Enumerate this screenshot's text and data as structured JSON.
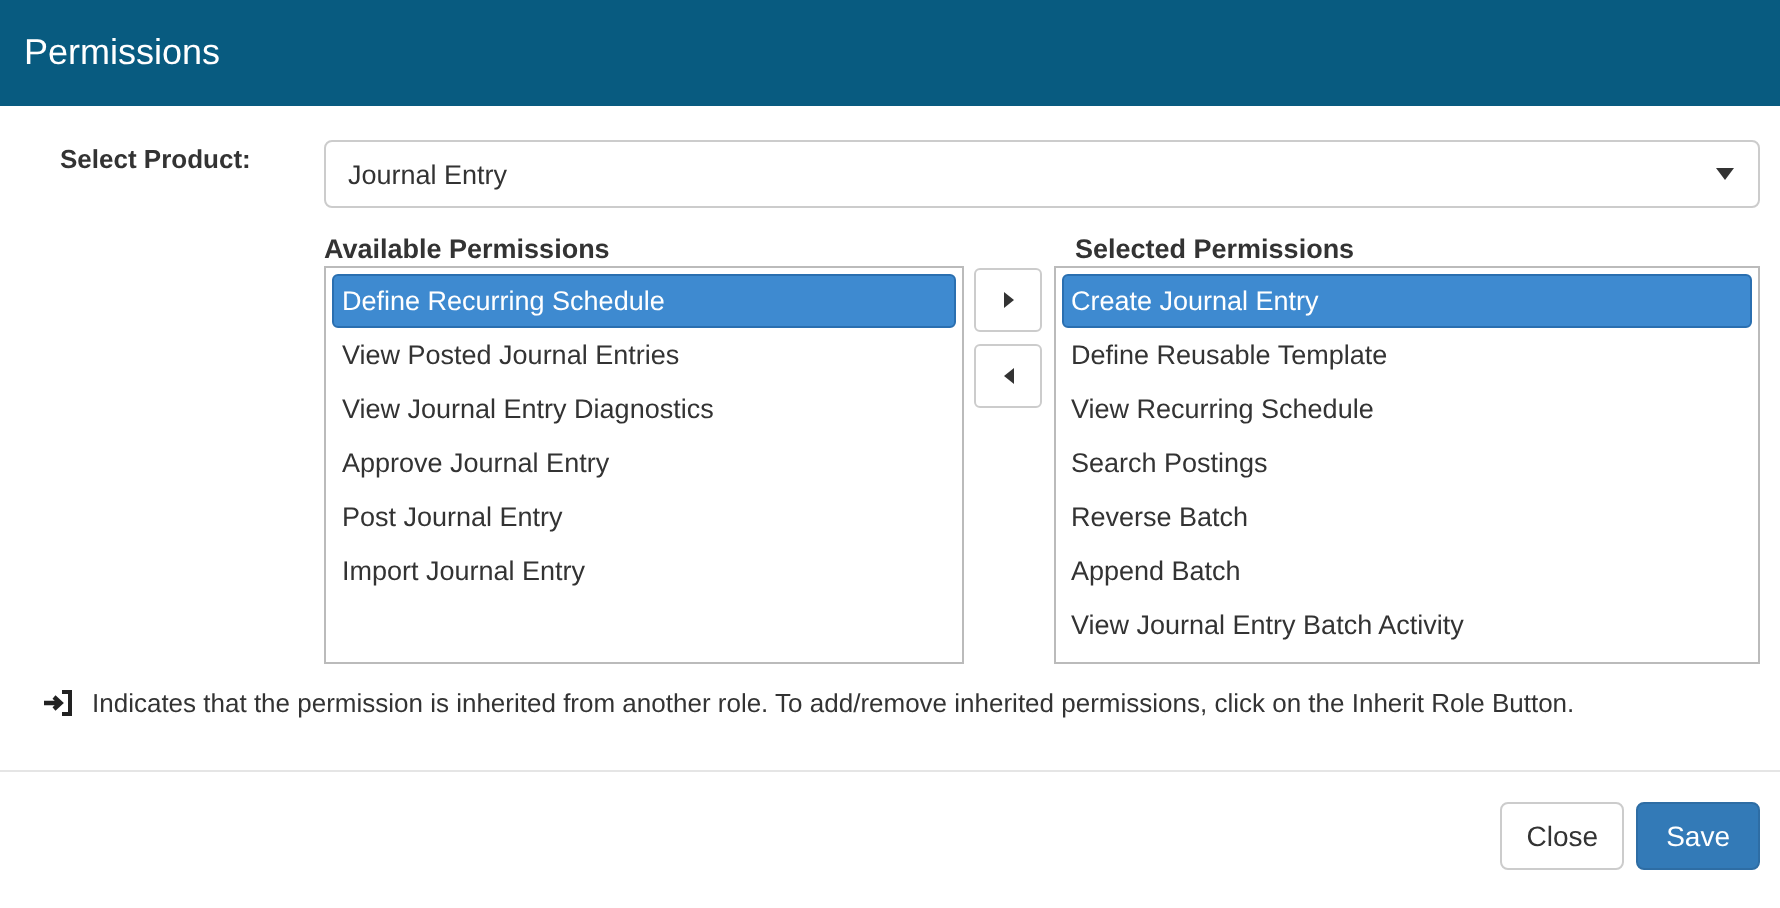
{
  "window": {
    "title": "Permissions"
  },
  "product": {
    "label": "Select Product:",
    "value": "Journal Entry"
  },
  "available": {
    "heading": "Available Permissions",
    "items": [
      {
        "label": "Define Recurring Schedule",
        "selected": true
      },
      {
        "label": "View Posted Journal Entries",
        "selected": false
      },
      {
        "label": "View Journal Entry Diagnostics",
        "selected": false
      },
      {
        "label": "Approve Journal Entry",
        "selected": false
      },
      {
        "label": "Post Journal Entry",
        "selected": false
      },
      {
        "label": "Import Journal Entry",
        "selected": false
      }
    ]
  },
  "selected_list": {
    "heading": "Selected Permissions",
    "items": [
      {
        "label": "Create Journal Entry",
        "selected": true
      },
      {
        "label": "Define Reusable Template",
        "selected": false
      },
      {
        "label": "View Recurring Schedule",
        "selected": false
      },
      {
        "label": "Search Postings",
        "selected": false
      },
      {
        "label": "Reverse Batch",
        "selected": false
      },
      {
        "label": "Append Batch",
        "selected": false
      },
      {
        "label": "View Journal Entry Batch Activity",
        "selected": false
      }
    ]
  },
  "note": "Indicates that the permission is inherited from another role. To add/remove inherited permissions, click on the Inherit Role Button.",
  "buttons": [
    {
      "label": "Close",
      "kind": "default"
    },
    {
      "label": "Save",
      "kind": "primary"
    }
  ]
}
